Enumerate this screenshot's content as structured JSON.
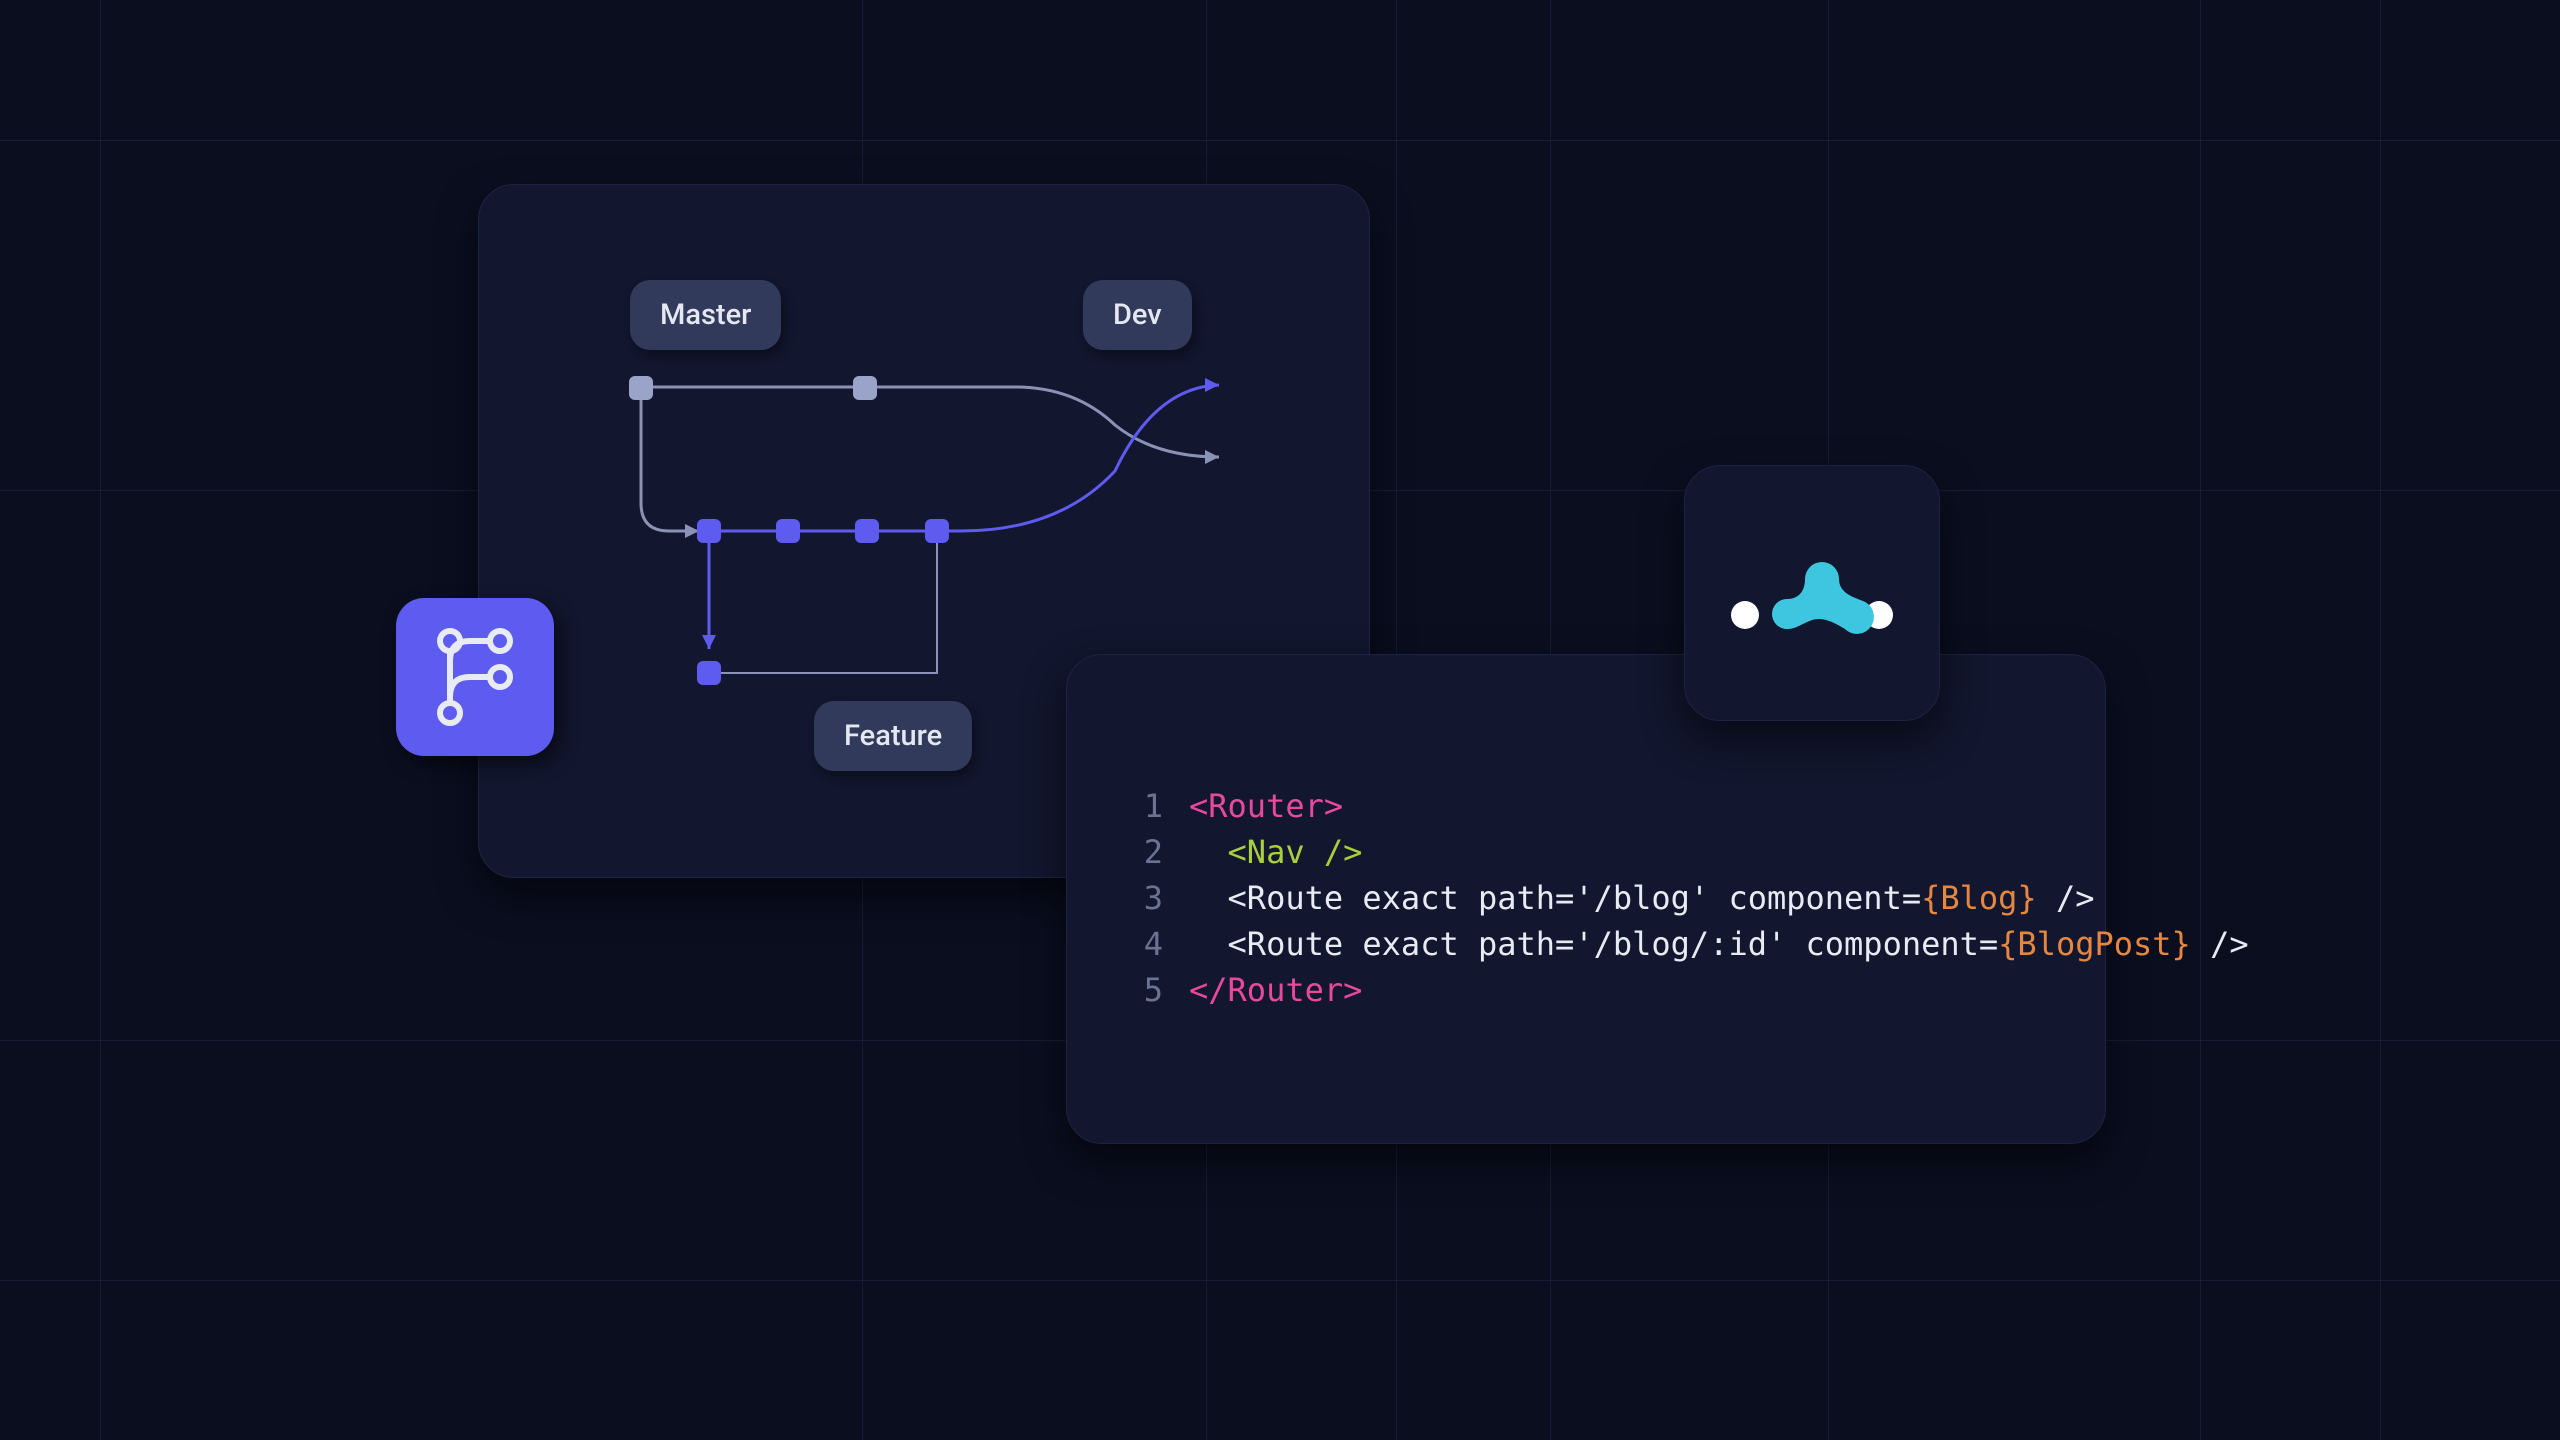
{
  "git_card": {
    "branches": {
      "master": "Master",
      "dev": "Dev",
      "feature": "Feature"
    }
  },
  "code_card": {
    "lines": [
      {
        "n": "1",
        "indent": "",
        "segments": [
          {
            "cls": "c-pink",
            "t": "<Router>"
          }
        ]
      },
      {
        "n": "2",
        "indent": "  ",
        "segments": [
          {
            "cls": "c-green",
            "t": "<Nav />"
          }
        ]
      },
      {
        "n": "3",
        "indent": "  ",
        "segments": [
          {
            "cls": "c-white",
            "t": "<Route exact path='/blog' component="
          },
          {
            "cls": "c-orange",
            "t": "{Blog}"
          },
          {
            "cls": "c-white",
            "t": " />"
          }
        ]
      },
      {
        "n": "4",
        "indent": "  ",
        "segments": [
          {
            "cls": "c-white",
            "t": "<Route exact path='/blog/:id' component="
          },
          {
            "cls": "c-orange",
            "t": "{BlogPost}"
          },
          {
            "cls": "c-white",
            "t": " />"
          }
        ]
      },
      {
        "n": "5",
        "indent": "",
        "segments": [
          {
            "cls": "c-pink",
            "t": "</Router>"
          }
        ]
      }
    ]
  },
  "icons": {
    "git_branch": "git-branch-icon",
    "logo": "react-router-logo"
  },
  "colors": {
    "accent_blue": "#5e5cf0",
    "card_bg": "#12162e",
    "bg": "#0a0e1f",
    "chip": "#323a5c",
    "node_gray": "#9aa3c8",
    "arrow_gray": "#8a93b5",
    "code_pink": "#e6499e",
    "code_green": "#a8cf3d",
    "code_orange": "#e7863f",
    "code_white": "#e8ebf2",
    "logo_cyan": "#3ec6e0",
    "logo_white": "#ffffff"
  }
}
